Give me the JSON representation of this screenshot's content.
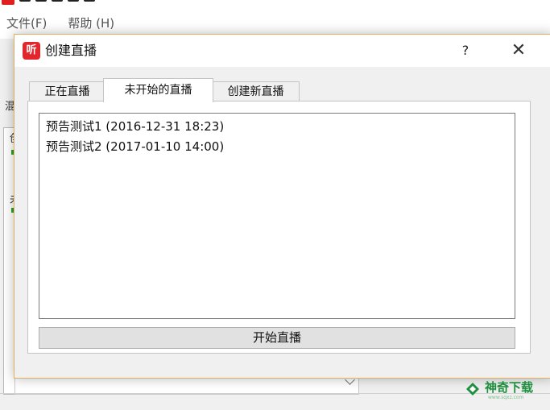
{
  "main_window": {
    "menu": [
      "文件(F)",
      "帮助 (H)"
    ],
    "side_glyphs": [
      "混",
      "创",
      "未"
    ]
  },
  "dialog": {
    "icon_glyph": "听",
    "title": "创建直播",
    "help_label": "?",
    "close_label": "✕",
    "tabs": [
      {
        "label": "正在直播",
        "active": false
      },
      {
        "label": "未开始的直播",
        "active": true
      },
      {
        "label": "创建新直播",
        "active": false
      }
    ],
    "list_items": [
      "预告测试1 (2016-12-31 18:23)",
      "预告测试2 (2017-01-10 14:00)"
    ],
    "start_button": "开始直播"
  },
  "watermark": {
    "text": "神奇下载",
    "sub": "www.sqxz.com"
  },
  "colors": {
    "accent_red": "#e3262d",
    "dialog_border": "#e0b060",
    "watermark_green": "#1d8f3e"
  }
}
